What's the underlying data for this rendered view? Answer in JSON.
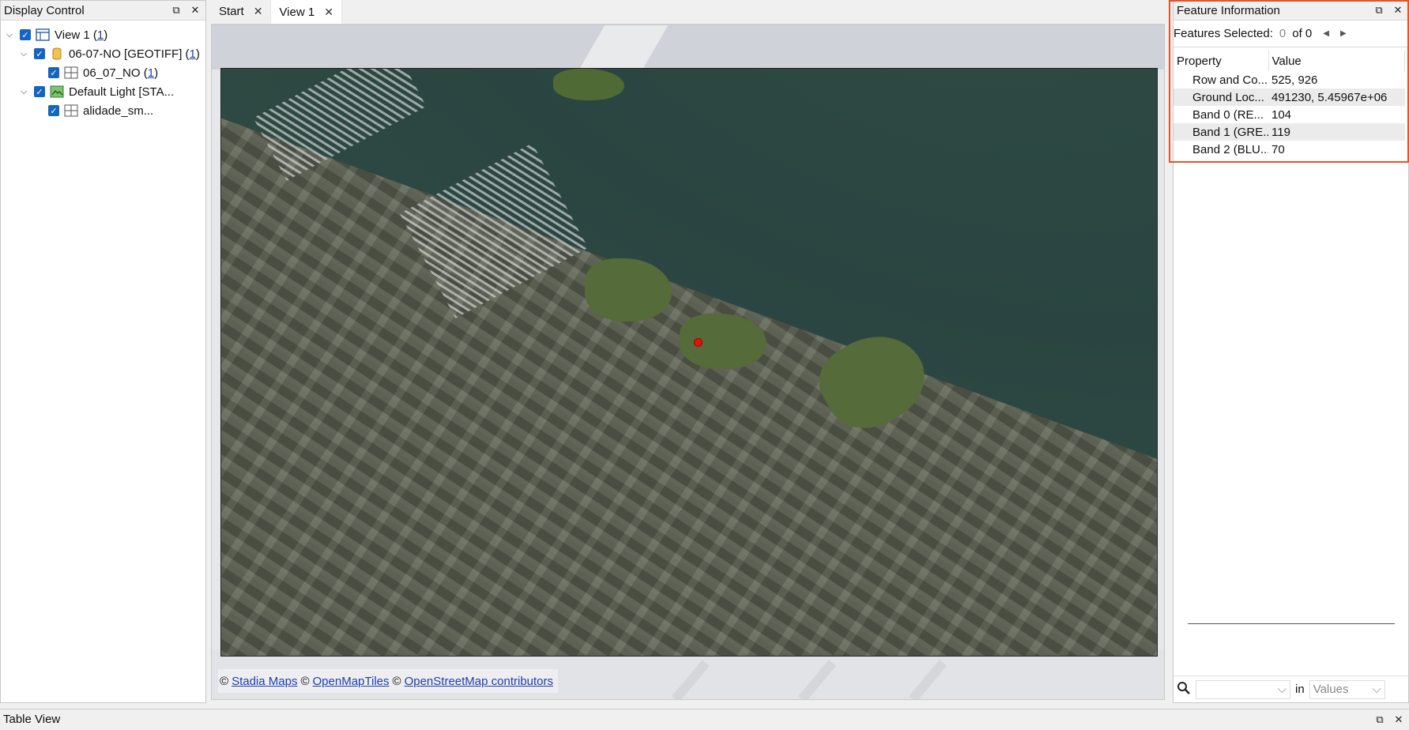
{
  "display_control": {
    "title": "Display Control",
    "tree": [
      {
        "label": "View 1 ( ",
        "count": "1",
        "suffix": ")"
      },
      {
        "label": "06-07-NO [GEOTIFF] ( ",
        "count": "1",
        "suffix": ")"
      },
      {
        "label": "06_07_NO ( ",
        "count": "1",
        "suffix": ")"
      },
      {
        "label": "Default Light [STA...",
        "count": "",
        "suffix": ""
      },
      {
        "label": "alidade_sm...",
        "count": "",
        "suffix": ""
      }
    ]
  },
  "tabs": [
    {
      "label": "Start"
    },
    {
      "label": "View 1"
    }
  ],
  "map": {
    "attribution_prefix": "©",
    "links": [
      "Stadia Maps",
      "OpenMapTiles",
      "OpenStreetMap contributors"
    ],
    "sep": "©"
  },
  "feature_info": {
    "title": "Feature Information",
    "features_selected_label": "Features Selected:",
    "selected_count": "0",
    "of_label": "of 0",
    "headers": {
      "property": "Property",
      "value": "Value"
    },
    "rows": [
      {
        "property": "Row and Co...",
        "value": "525, 926"
      },
      {
        "property": "Ground Loc...",
        "value": "491230, 5.45967e+06"
      },
      {
        "property": "Band 0 (RE...",
        "value": "104"
      },
      {
        "property": "Band 1 (GRE...",
        "value": "119"
      },
      {
        "property": "Band 2 (BLU...",
        "value": "70"
      }
    ],
    "search": {
      "in_label": "in",
      "field_value": "Values"
    }
  },
  "table_view": {
    "title": "Table View"
  },
  "colors": {
    "highlight": "#e8512a",
    "checkbox": "#1565c0",
    "marker": "#e0120f"
  }
}
